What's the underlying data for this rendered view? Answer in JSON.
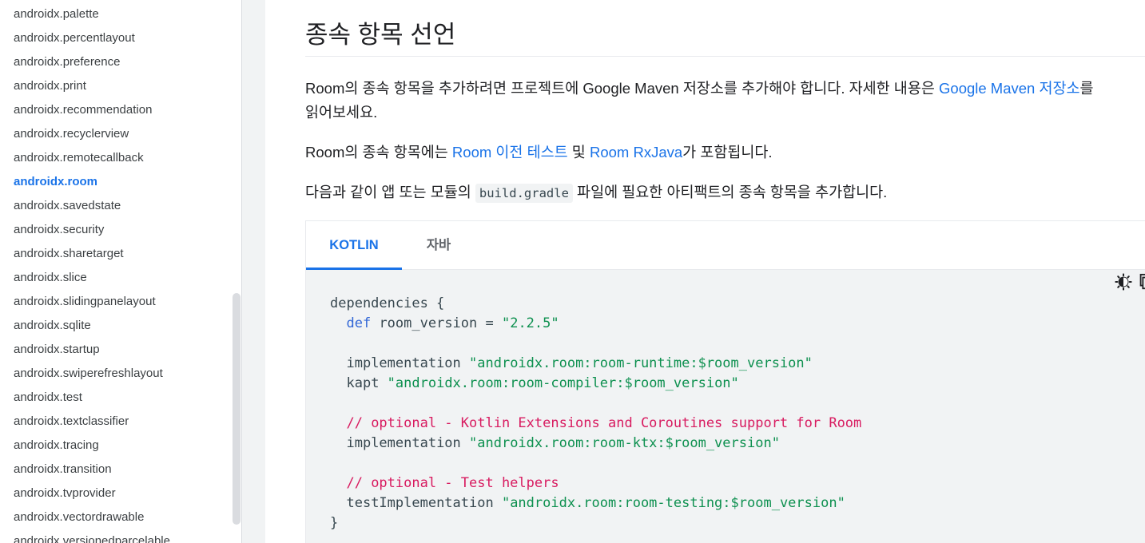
{
  "sidebar": {
    "items": [
      "androidx.palette",
      "androidx.percentlayout",
      "androidx.preference",
      "androidx.print",
      "androidx.recommendation",
      "androidx.recyclerview",
      "androidx.remotecallback",
      "androidx.room",
      "androidx.savedstate",
      "androidx.security",
      "androidx.sharetarget",
      "androidx.slice",
      "androidx.slidingpanelayout",
      "androidx.sqlite",
      "androidx.startup",
      "androidx.swiperefreshlayout",
      "androidx.test",
      "androidx.textclassifier",
      "androidx.tracing",
      "androidx.transition",
      "androidx.tvprovider",
      "androidx.vectordrawable",
      "androidx.versionedparcelable"
    ],
    "active_item": "androidx.room"
  },
  "main": {
    "heading": "종속 항목 선언",
    "p1": {
      "text_before": "Room의 종속 항목을 추가하려면 프로젝트에 Google Maven 저장소를 추가해야 합니다. 자세한 내용은 ",
      "link": "Google Maven 저장소",
      "text_after": "를",
      "line2": "읽어보세요."
    },
    "p2": {
      "text_before": "Room의 종속 항목에는 ",
      "link1": "Room 이전 테스트",
      "mid": " 및 ",
      "link2": "Room RxJava",
      "text_after": "가 포함됩니다."
    },
    "p3": {
      "text_before": "다음과 같이 앱 또는 모듈의 ",
      "code": "build.gradle",
      "text_after": " 파일에 필요한 아티팩트의 종속 항목을 추가합니다."
    },
    "tabs": [
      "KOTLIN",
      "자바"
    ],
    "active_tab": "KOTLIN",
    "code": {
      "l1": "dependencies {",
      "l2_kw": "def",
      "l2_mid": " room_version = ",
      "l2_str": "\"2.2.5\"",
      "l4_plain": "implementation ",
      "l4_str": "\"androidx.room:room-runtime:$room_version\"",
      "l5_plain": "kapt ",
      "l5_str": "\"androidx.room:room-compiler:$room_version\"",
      "l7_com": "// optional - Kotlin Extensions and Coroutines support for Room",
      "l8_plain": "implementation ",
      "l8_str": "\"androidx.room:room-ktx:$room_version\"",
      "l10_com": "// optional - Test helpers",
      "l11_plain": "testImplementation ",
      "l11_str": "\"androidx.room:room-testing:$room_version\"",
      "l12": "}"
    },
    "icons": {
      "theme": "dark-mode-toggle-icon",
      "copy": "copy-icon"
    }
  }
}
